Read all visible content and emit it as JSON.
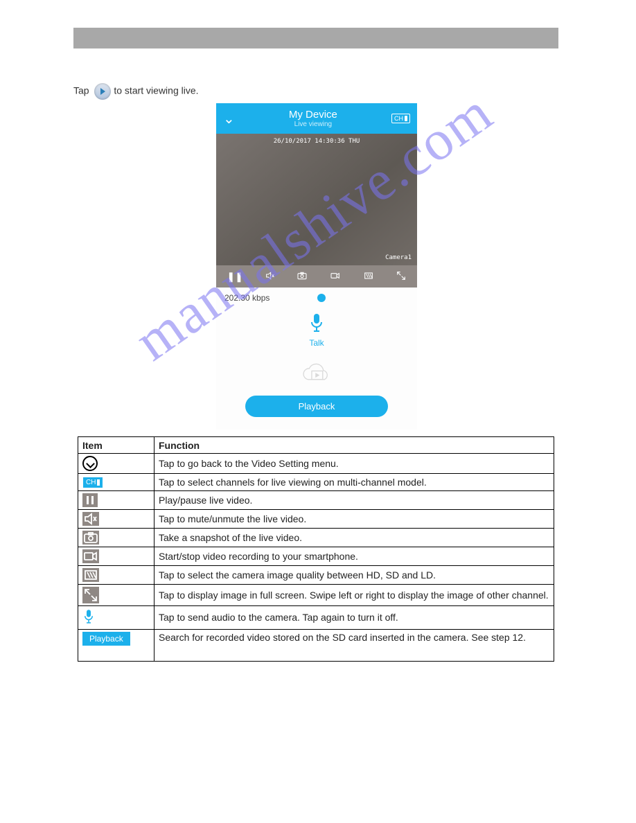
{
  "intro_prefix": "Tap",
  "intro_suffix": " to start viewing live.",
  "phone": {
    "title": "My Device",
    "subtitle": "Live viewing",
    "channel_badge": "CH",
    "timestamp": "26/10/2017 14:30:36 THU",
    "camera_label": "Camera1",
    "bitrate": "202.30 kbps",
    "talk_label": "Talk",
    "playback_button": "Playback"
  },
  "table": {
    "header_item": "Item",
    "header_func": "Function",
    "rows": [
      {
        "func": "Tap to go back to the Video Setting menu."
      },
      {
        "func": "Tap to select channels for live viewing on multi-channel model."
      },
      {
        "func": "Play/pause live video."
      },
      {
        "func": "Tap to mute/unmute the live video."
      },
      {
        "func": "Take a snapshot of the live video."
      },
      {
        "func": "Start/stop video recording to your smartphone."
      },
      {
        "func": "Tap to select the camera image quality between HD, SD and LD."
      },
      {
        "func": "Tap to display image in full screen. Swipe left or right to display the image of other channel."
      },
      {
        "func": "Tap to send audio to the camera. Tap again to turn it off."
      },
      {
        "func": "Search for recorded video stored on the SD card inserted in the camera. See step 12."
      }
    ],
    "playback_icon_text": "Playback"
  },
  "watermark": "manualshive.com"
}
